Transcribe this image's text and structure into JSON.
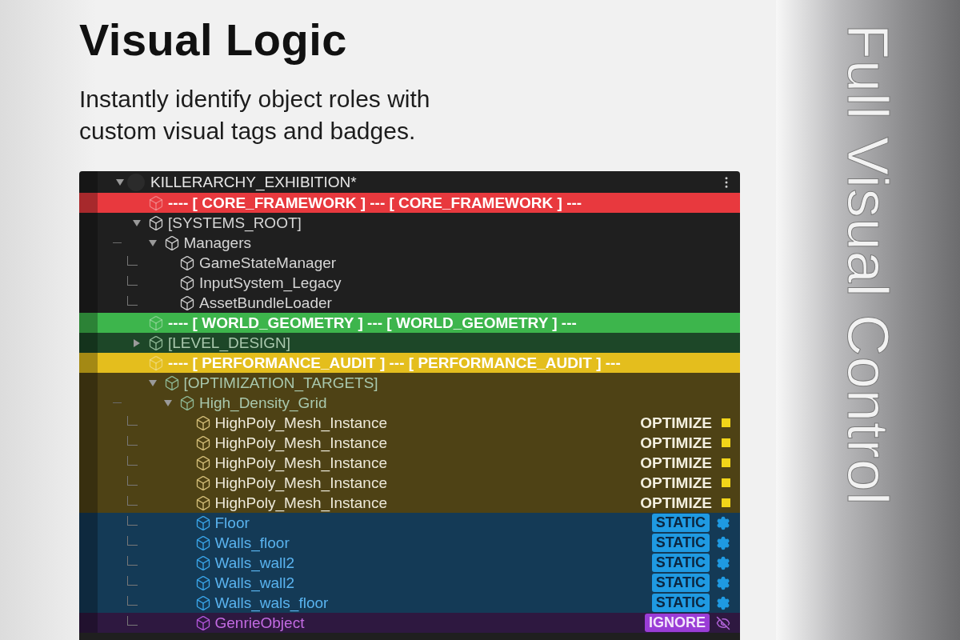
{
  "heading": {
    "title": "Visual Logic",
    "subtitle": "Instantly identify object roles with custom visual tags and badges."
  },
  "side_caption": "Full Visual Control",
  "hierarchy": {
    "title": "KILLERARCHY_EXHIBITION*",
    "expanded": true,
    "items": [
      {
        "kind": "separator",
        "label": "---- [ CORE_FRAMEWORK ] --- [ CORE_FRAMEWORK ] ---",
        "color": "#e8393e"
      },
      {
        "kind": "object",
        "label": "[SYSTEMS_ROOT]",
        "expanded": true,
        "children": [
          {
            "kind": "object",
            "label": "Managers",
            "expanded": true,
            "tree_line": true,
            "children": [
              {
                "kind": "object",
                "label": "GameStateManager",
                "tree_line": true
              },
              {
                "kind": "object",
                "label": "InputSystem_Legacy",
                "tree_line": true
              },
              {
                "kind": "object",
                "label": "AssetBundleLoader",
                "tree_line": true
              }
            ]
          }
        ]
      },
      {
        "kind": "separator",
        "label": "---- [ WORLD_GEOMETRY ] --- [ WORLD_GEOMETRY ] ---",
        "color": "#3db54c"
      },
      {
        "kind": "object",
        "label": "[LEVEL_DESIGN]",
        "expanded": false,
        "color": "#1d4728"
      },
      {
        "kind": "separator",
        "label": "---- [ PERFORMANCE_AUDIT ] --- [ PERFORMANCE_AUDIT ] ---",
        "color": "#e4be1d",
        "children": [
          {
            "kind": "object",
            "label": "[OPTIMIZATION_TARGETS]",
            "expanded": true,
            "color": "#4e4215",
            "children": [
              {
                "kind": "object",
                "label": "High_Density_Grid",
                "expanded": true,
                "tree_line": true,
                "color": "#4e4215",
                "children": [
                  {
                    "kind": "object",
                    "label": "HighPoly_Mesh_Instance",
                    "tree_line": true,
                    "color": "#4e4215",
                    "tag": {
                      "kind": "optimize",
                      "label": "OPTIMIZE"
                    }
                  },
                  {
                    "kind": "object",
                    "label": "HighPoly_Mesh_Instance",
                    "tree_line": true,
                    "color": "#4e4215",
                    "tag": {
                      "kind": "optimize",
                      "label": "OPTIMIZE"
                    }
                  },
                  {
                    "kind": "object",
                    "label": "HighPoly_Mesh_Instance",
                    "tree_line": true,
                    "color": "#4e4215",
                    "tag": {
                      "kind": "optimize",
                      "label": "OPTIMIZE"
                    }
                  },
                  {
                    "kind": "object",
                    "label": "HighPoly_Mesh_Instance",
                    "tree_line": true,
                    "color": "#4e4215",
                    "tag": {
                      "kind": "optimize",
                      "label": "OPTIMIZE"
                    }
                  },
                  {
                    "kind": "object",
                    "label": "HighPoly_Mesh_Instance",
                    "tree_line": true,
                    "color": "#4e4215",
                    "tag": {
                      "kind": "optimize",
                      "label": "OPTIMIZE"
                    }
                  },
                  {
                    "kind": "object",
                    "label": "Floor",
                    "tree_line": true,
                    "color": "#143a56",
                    "tag": {
                      "kind": "static",
                      "label": "STATIC"
                    }
                  },
                  {
                    "kind": "object",
                    "label": "Walls_floor",
                    "tree_line": true,
                    "color": "#143a56",
                    "tag": {
                      "kind": "static",
                      "label": "STATIC"
                    }
                  },
                  {
                    "kind": "object",
                    "label": "Walls_wall2",
                    "tree_line": true,
                    "color": "#143a56",
                    "tag": {
                      "kind": "static",
                      "label": "STATIC"
                    }
                  },
                  {
                    "kind": "object",
                    "label": "Walls_wall2",
                    "tree_line": true,
                    "color": "#143a56",
                    "tag": {
                      "kind": "static",
                      "label": "STATIC"
                    }
                  },
                  {
                    "kind": "object",
                    "label": "Walls_wals_floor",
                    "tree_line": true,
                    "color": "#143a56",
                    "tag": {
                      "kind": "static",
                      "label": "STATIC"
                    }
                  },
                  {
                    "kind": "object",
                    "label": "GenrieObject",
                    "tree_line": true,
                    "color": "#2e1840",
                    "tag": {
                      "kind": "ignore",
                      "label": "IGNORE"
                    }
                  }
                ]
              }
            ]
          }
        ]
      }
    ]
  }
}
